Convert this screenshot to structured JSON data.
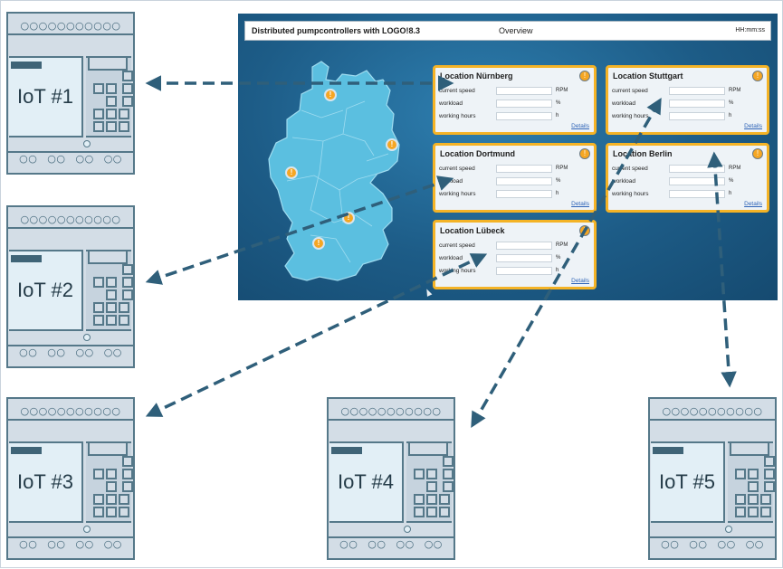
{
  "dashboard": {
    "title": "Distributed pumpcontrollers with LOGO!8.3",
    "view": "Overview",
    "clock": "HH:mm:ss",
    "field_labels": {
      "speed": "current speed",
      "workload": "workload",
      "hours": "working hours"
    },
    "units": {
      "speed": "RPM",
      "workload": "%",
      "hours": "h"
    },
    "details_link": "Details",
    "locations": [
      {
        "name": "Location Nürnberg",
        "badge": "!"
      },
      {
        "name": "Location Stuttgart",
        "badge": "!"
      },
      {
        "name": "Location Dortmund",
        "badge": "!"
      },
      {
        "name": "Location Berlin",
        "badge": "!"
      },
      {
        "name": "Location Lübeck",
        "badge": "!"
      }
    ],
    "map_pin": "!",
    "colors": {
      "card_border": "#f4b326",
      "background": "#1d5c87",
      "map": "#5bbfe0",
      "link": "#2e63b7"
    }
  },
  "devices": [
    {
      "label": "IoT #1",
      "top_terminals": "○○○○○○○○○○○",
      "bottom_terminals": "○○ ○○ ○○ ○○"
    },
    {
      "label": "IoT #2",
      "top_terminals": "○○○○○○○○○○○",
      "bottom_terminals": "○○ ○○ ○○ ○○"
    },
    {
      "label": "IoT #3",
      "top_terminals": "○○○○○○○○○○○",
      "bottom_terminals": "○○ ○○ ○○ ○○"
    },
    {
      "label": "IoT #4",
      "top_terminals": "○○○○○○○○○○○",
      "bottom_terminals": "○○ ○○ ○○ ○○"
    },
    {
      "label": "IoT #5",
      "top_terminals": "○○○○○○○○○○○",
      "bottom_terminals": "○○ ○○ ○○ ○○"
    }
  ],
  "colors": {
    "device_fill": "#d3dde6",
    "device_stroke": "#557889",
    "arrow": "#2f5f7a"
  }
}
